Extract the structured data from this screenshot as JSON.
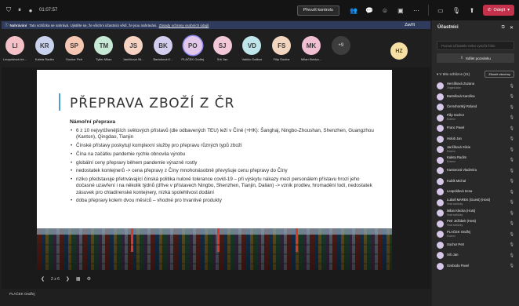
{
  "topbar": {
    "timer": "01:07:57",
    "control_label": "Převzít kontrolu",
    "leave_label": "Odejít"
  },
  "banner": {
    "bold": "Nahrávání",
    "text": "Tato schůzka se nahrává. Ujistěte se, že všichni účastníci vědí, že jsou nahráváni.",
    "link": "Zásady ochrany osobních údajů",
    "close": "Zavřít"
  },
  "participants_strip": [
    {
      "initials": "LI",
      "name": "Leopoldová Ire...",
      "color": "#f4c1c9"
    },
    {
      "initials": "KR",
      "name": "Kaleta Radim",
      "color": "#c9d3ee"
    },
    {
      "initials": "SP",
      "name": "Sochor Petr",
      "color": "#f6c8b4"
    },
    {
      "initials": "TM",
      "name": "Tyller Milan",
      "color": "#c6e8d4"
    },
    {
      "initials": "JS",
      "name": "Jančíková Sil...",
      "color": "#f7d3c3"
    },
    {
      "initials": "BK",
      "name": "Bartošová K...",
      "color": "#d3cdee"
    },
    {
      "initials": "PO",
      "name": "PLAČEK Ondřej",
      "color": "#e2c7ea"
    },
    {
      "initials": "SJ",
      "name": "Srb Jan",
      "color": "#f2c7d8"
    },
    {
      "initials": "VD",
      "name": "Vašíko Dalibor",
      "color": "#bfe6ea"
    },
    {
      "initials": "FS",
      "name": "Filip Sochor",
      "color": "#f3d6c0"
    },
    {
      "initials": "MK",
      "name": "Milan Klecka...",
      "color": "#f1bfd2"
    }
  ],
  "more_label": "+9",
  "floating_avatar": {
    "initials": "HZ"
  },
  "slide": {
    "title": "PŘEPRAVA ZBOŽÍ Z ČR",
    "subtitle": "Námořní přeprava",
    "bullets": [
      "6 z 10 nejvytíženějších světových přístavů (dle odbavených TEU) leží v Číně (+HK): Šanghaj, Ningbo-Zhoushan, Shenzhen, Guangzhou (Kanton), Qingdao, Tianjin",
      "Čínské přístavy poskytují komplexní služby pro přepravu různých typů zboží",
      "Čína na začátku pandemie rychle obnovila výrobu",
      "globální ceny přepravy během pandemie výrazně rostly",
      "nedostatek kontejnerů -> cena přepravy z Číny mnohonásobně převyšuje cenu přepravy do Číny",
      "riziko představuje přetrvávající čínská politika nulové tolerance covid-19 – při výskytu nákazy mezi personálem přístavu hrozí jeho dočasné uzavření i na několik týdnů (dříve v přístavech Ningbo, Shenzhen, Tianjin, Dalian) -> vznik prodlev, hromadění lodí, nedostatek zásuvek pro chladírenské kontejnery, nízká spolehlivost dodání",
      "doba přepravy kolem dvou měsíců – vhodné pro trvanlivé produkty"
    ]
  },
  "slide_nav": {
    "page": "2 z 6"
  },
  "self_name": "PLAČEK Ondřej",
  "panel": {
    "title": "Účastníci",
    "search_placeholder": "Pozvat uživatele nebo vytočit číslo",
    "share_label": "Sdílet pozvánku",
    "meeting_label": "V této schůzce (21)",
    "mute_all": "Ztlumit všechny",
    "people": [
      {
        "name": "Herclíková Zuzana",
        "role": "Organizátor"
      },
      {
        "name": "Bartošová Karolína",
        "role": ""
      },
      {
        "name": "Černohorský Roland",
        "role": ""
      },
      {
        "name": "Filip Sochor",
        "role": "Externí"
      },
      {
        "name": "Franc Pavel",
        "role": ""
      },
      {
        "name": "Holub Jan",
        "role": ""
      },
      {
        "name": "Jančíková Silvie",
        "role": "Externí"
      },
      {
        "name": "Kaleta Radim",
        "role": "Externí"
      },
      {
        "name": "Kantorová Vladimíra",
        "role": ""
      },
      {
        "name": "Kubík Michal",
        "role": ""
      },
      {
        "name": "Leopoldová Irena",
        "role": ""
      },
      {
        "name": "Luboš MAREK (Guest) (Host)",
        "role": "Host schůzky"
      },
      {
        "name": "Milan Klecka (Host)",
        "role": "Host schůzky"
      },
      {
        "name": "Petr Ježábek (Host)",
        "role": "Host schůzky"
      },
      {
        "name": "PLAČEK Ondřej",
        "role": "Externí"
      },
      {
        "name": "Sochor Petr",
        "role": ""
      },
      {
        "name": "Srb Jan",
        "role": ""
      },
      {
        "name": "Svoboda Pavel",
        "role": ""
      }
    ]
  }
}
